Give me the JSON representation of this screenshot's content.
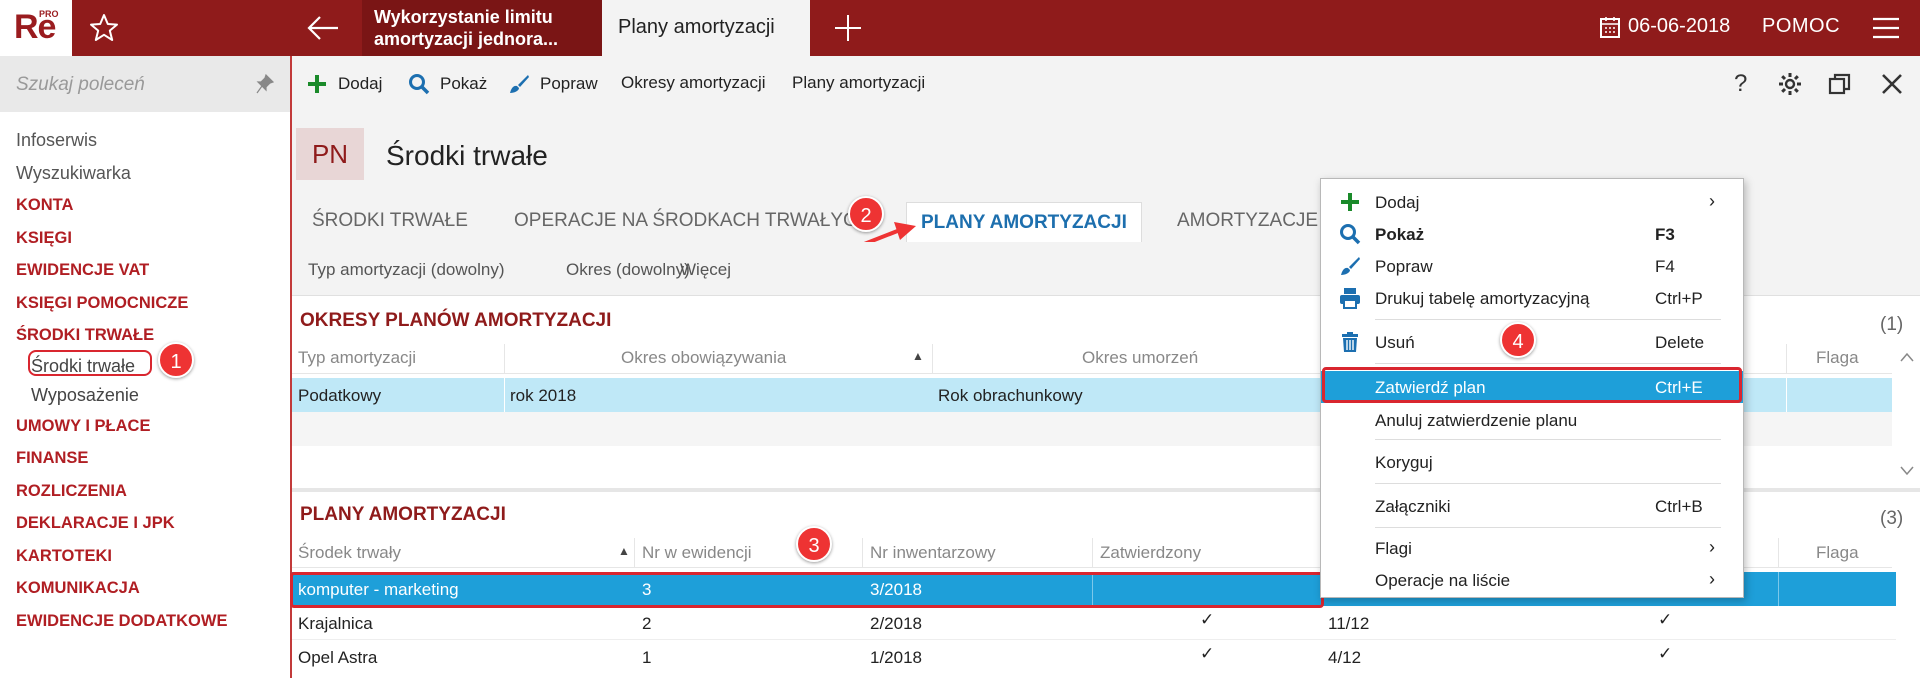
{
  "topbar": {
    "logo": "Re",
    "logo_sup": "PRO",
    "tab1": "Wykorzystanie limitu amortyzacji jednora...",
    "tab2": "Plany amortyzacji",
    "date": "06-06-2018",
    "help": "POMOC",
    "colors": {
      "bar": "#8f1b1b",
      "active_tab": "#f3f3f3"
    }
  },
  "sidebar": {
    "search_placeholder": "Szukaj poleceń",
    "items": [
      {
        "label": "Infoserwis"
      },
      {
        "label": "Wyszukiwarka"
      },
      {
        "label": "KONTA"
      },
      {
        "label": "KSIĘGI"
      },
      {
        "label": "EWIDENCJE VAT"
      },
      {
        "label": "KSIĘGI POMOCNICZE"
      },
      {
        "label": "ŚRODKI TRWAŁE"
      },
      {
        "label": "Środki trwałe"
      },
      {
        "label": "Wyposażenie"
      },
      {
        "label": "UMOWY I PŁACE"
      },
      {
        "label": "FINANSE"
      },
      {
        "label": "ROZLICZENIA"
      },
      {
        "label": "DEKLARACJE I JPK"
      },
      {
        "label": "KARTOTEKI"
      },
      {
        "label": "KOMUNIKACJA"
      },
      {
        "label": "EWIDENCJE DODATKOWE"
      }
    ]
  },
  "toolbar": {
    "add": "Dodaj",
    "show": "Pokaż",
    "edit": "Popraw",
    "periods": "Okresy amortyzacji",
    "plans": "Plany amortyzacji",
    "question": "?"
  },
  "header": {
    "badge": "PN",
    "title": "Środki trwałe"
  },
  "tabs": [
    "ŚRODKI TRWAŁE",
    "OPERACJE NA ŚRODKACH TRWAŁYCH",
    "PLANY AMORTYZACJI",
    "AMORTYZACJE"
  ],
  "filters": [
    "Typ amortyzacji (dowolny)",
    "Okres (dowolny)",
    "Więcej"
  ],
  "periods_section": {
    "title": "OKRESY PLANÓW AMORTYZACJI",
    "count": "(1)",
    "columns": [
      "Typ amortyzacji",
      "Okres obowiązywania",
      "Okres umorzeń",
      "Flaga"
    ],
    "rows": [
      [
        "Podatkowy",
        "rok 2018",
        "Rok obrachunkowy"
      ]
    ]
  },
  "plans_section": {
    "title": "PLANY AMORTYZACJI",
    "count": "(3)",
    "columns": [
      "Środek trwały",
      "Nr w ewidencji",
      "Nr inwentarzowy",
      "Zatwierdzony",
      "Flaga"
    ],
    "rows": [
      {
        "name": "komputer - marketing",
        "nr_ew": "3",
        "nr_inw": "3/2018",
        "months": "",
        "approved": false
      },
      {
        "name": "Krajalnica",
        "nr_ew": "2",
        "nr_inw": "2/2018",
        "months": "11/12",
        "approved": true
      },
      {
        "name": "Opel Astra",
        "nr_ew": "1",
        "nr_inw": "1/2018",
        "months": "4/12",
        "approved": true
      }
    ]
  },
  "context_menu": {
    "items": [
      {
        "label": "Dodaj",
        "shortcut": "",
        "submenu": true
      },
      {
        "label": "Pokaż",
        "shortcut": "F3"
      },
      {
        "label": "Popraw",
        "shortcut": "F4"
      },
      {
        "label": "Drukuj tabelę amortyzacyjną",
        "shortcut": "Ctrl+P"
      },
      {
        "label": "Usuń",
        "shortcut": "Delete"
      },
      {
        "label": "Zatwierdź plan",
        "shortcut": "Ctrl+E"
      },
      {
        "label": "Anuluj zatwierdzenie planu",
        "shortcut": ""
      },
      {
        "label": "Koryguj",
        "shortcut": ""
      },
      {
        "label": "Załączniki",
        "shortcut": "Ctrl+B"
      },
      {
        "label": "Flagi",
        "shortcut": "",
        "submenu": true
      },
      {
        "label": "Operacje na liście",
        "shortcut": "",
        "submenu": true
      }
    ]
  },
  "callouts": [
    "1",
    "2",
    "3",
    "4"
  ],
  "check_mark": "✓",
  "submenu_arrow": "›",
  "sort_arrow": "▲",
  "colors": {
    "accent": "#8f1b1b",
    "selection": "#1e9fd9",
    "light_selection": "#bfe8f7",
    "highlight": "#d9262f"
  }
}
